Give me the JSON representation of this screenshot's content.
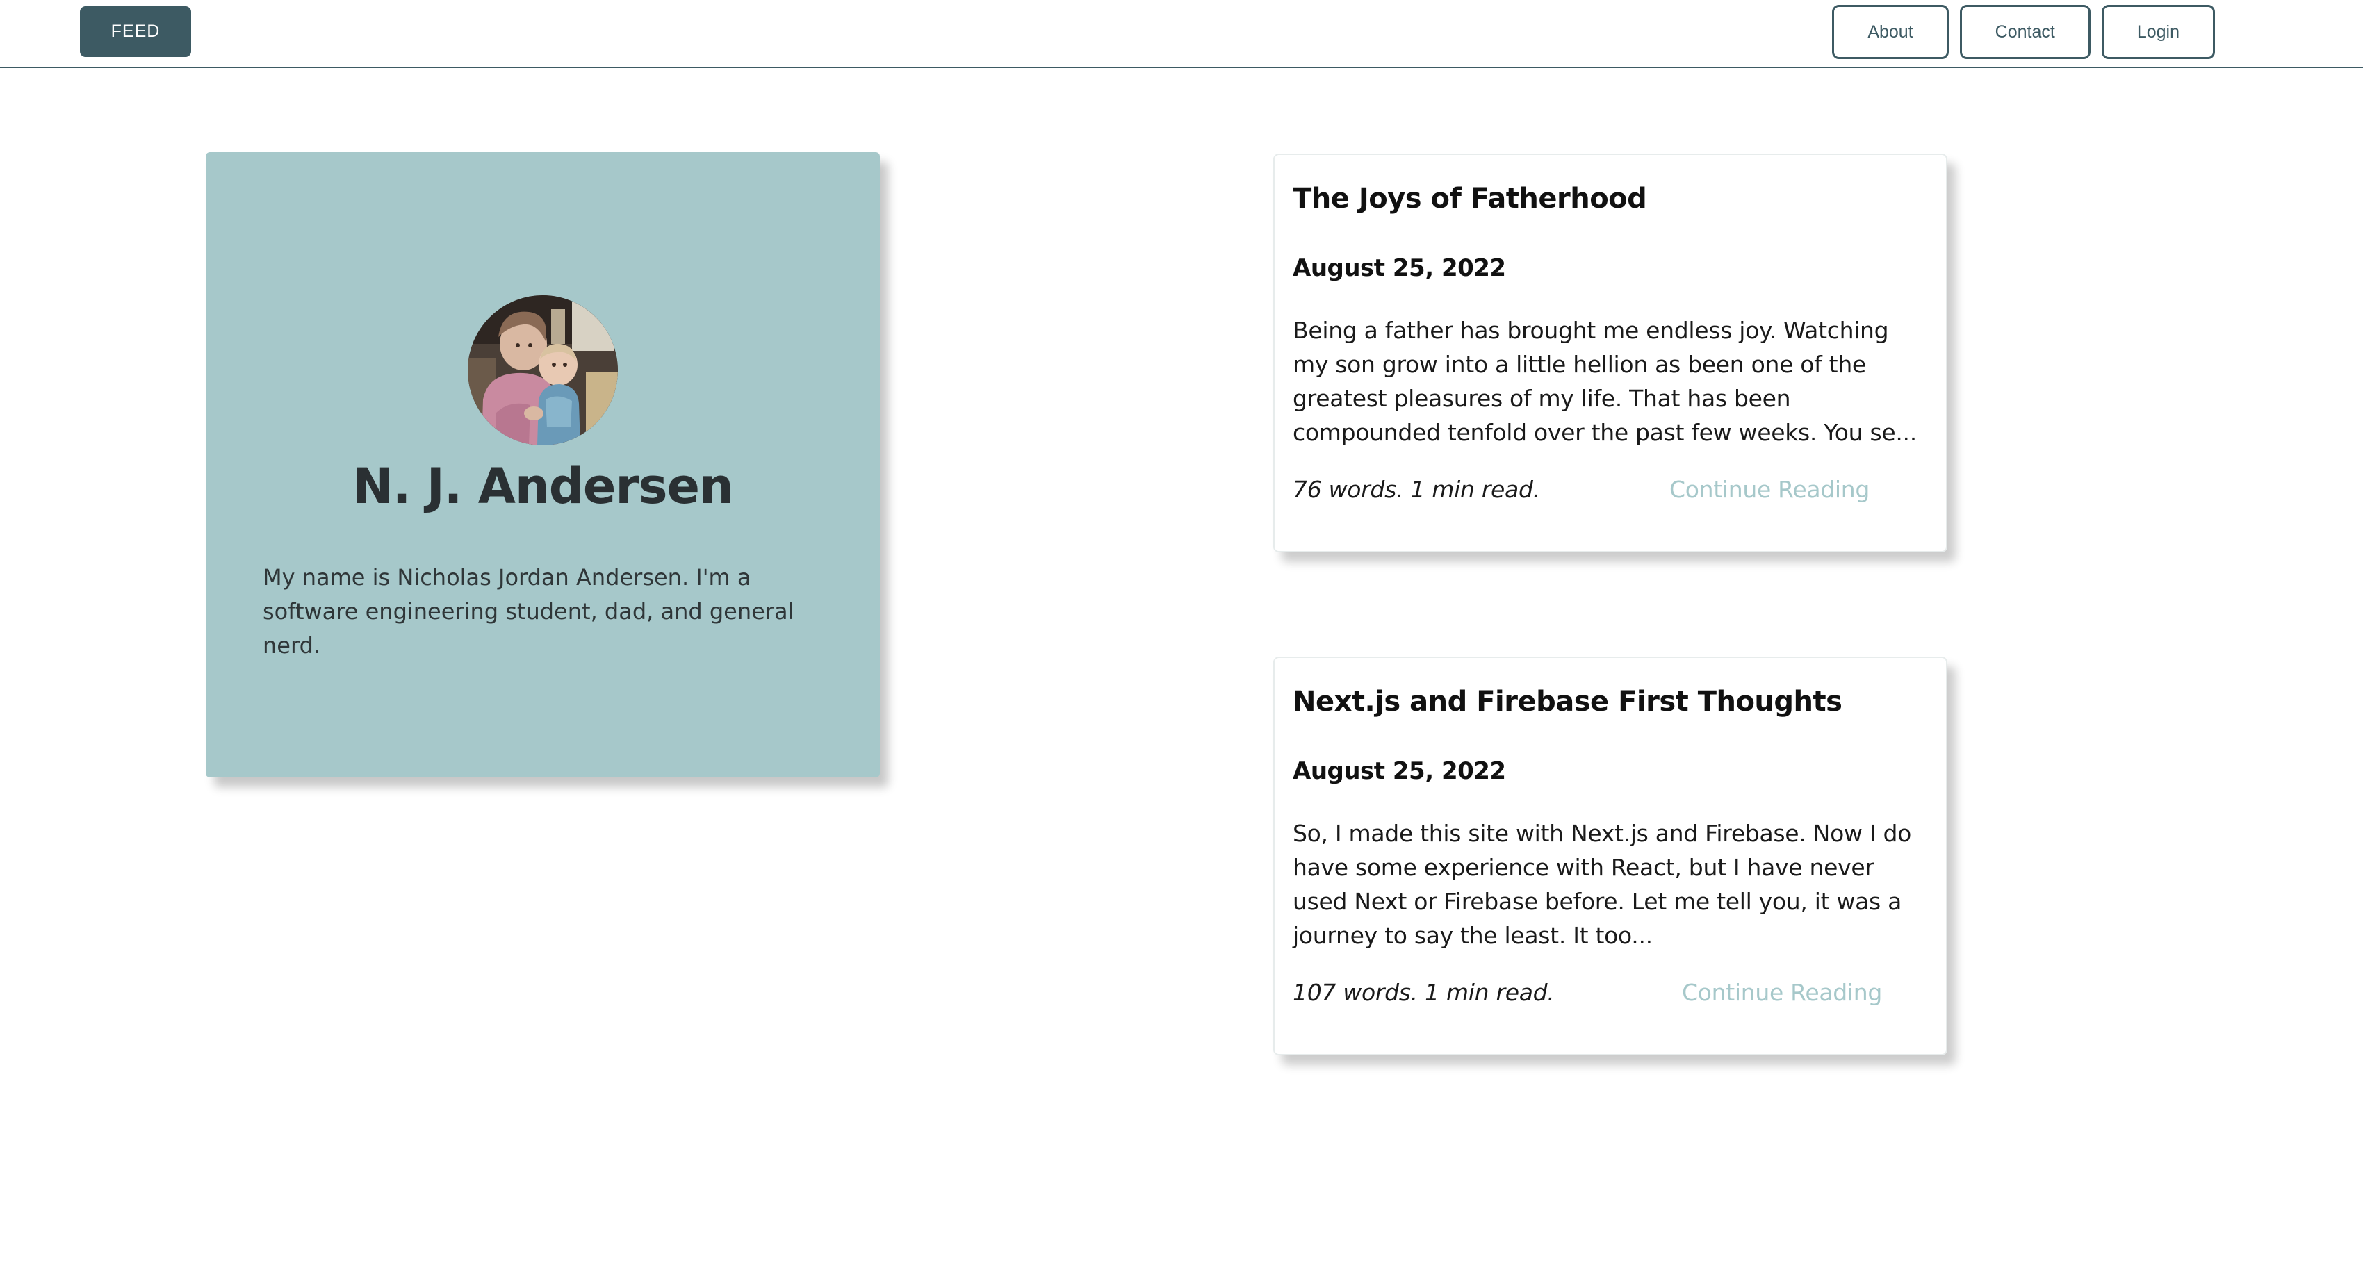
{
  "nav": {
    "feed_label": "FEED",
    "links": [
      {
        "label": "About"
      },
      {
        "label": "Contact"
      },
      {
        "label": "Login"
      }
    ]
  },
  "profile": {
    "name": "N. J. Andersen",
    "bio": "My name is Nicholas Jordan Andersen. I'm a software engineering student, dad, and general nerd.",
    "avatar_icon": "profile-photo"
  },
  "posts": [
    {
      "title": "The Joys of Fatherhood",
      "date": "August 25, 2022",
      "excerpt": "Being a father has brought me endless joy. Watching my son grow into a little hellion as been one of the greatest pleasures of my life. That has been compounded tenfold over the past few weeks. You se...",
      "meta": "76 words. 1 min read.",
      "link_label": "Continue Reading"
    },
    {
      "title": "Next.js and Firebase First Thoughts",
      "date": "August 25, 2022",
      "excerpt": "So, I made this site with Next.js and Firebase. Now I do have some experience with React, but I have never used Next or Firebase before. Let me tell you, it was a journey to say the least. It too...",
      "meta": "107 words. 1 min read.",
      "link_label": "Continue Reading"
    }
  ],
  "colors": {
    "primary": "#3d5a63",
    "card_bg": "#a6c8ca",
    "link": "#a6c8ca"
  }
}
